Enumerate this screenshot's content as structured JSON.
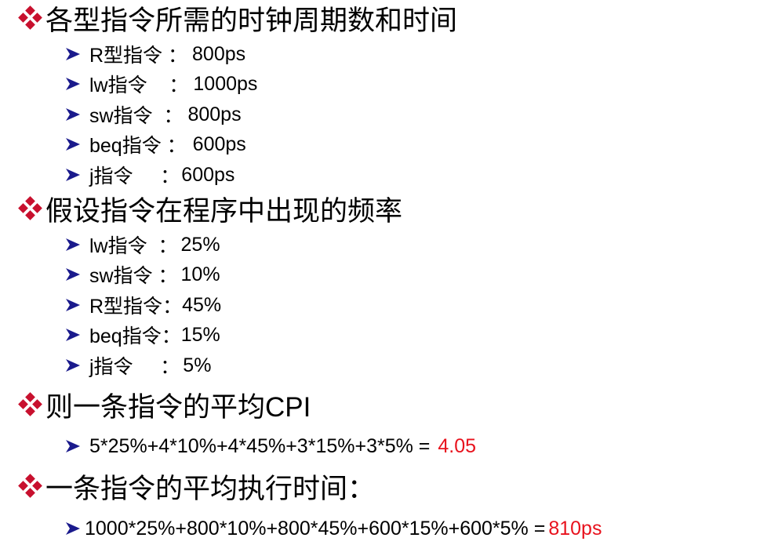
{
  "colors": {
    "accent": "#e8121d",
    "arrow": "#1a1a8c",
    "diamond": "#c8102e",
    "text": "#000000"
  },
  "icons": {
    "heading_marker": "diamond-quad-icon",
    "item_marker": "arrowhead-right-icon"
  },
  "sections": [
    {
      "title": "各型指令所需的时钟周期数和时间",
      "items": [
        {
          "label": "R型指令",
          "sep": " ：",
          "value": "800ps"
        },
        {
          "label": "lw指令",
          "sep": "    ：",
          "value": "1000ps"
        },
        {
          "label": "sw指令",
          "sep": "  ：",
          "value": "800ps"
        },
        {
          "label": "beq指令",
          "sep": " ：",
          "value": "600ps"
        },
        {
          "label": "j指令",
          "sep": "     ：",
          "value": "600ps"
        }
      ]
    },
    {
      "title": "假设指令在程序中出现的频率",
      "items": [
        {
          "label": "lw指令",
          "sep": "  ：",
          "value": "25%"
        },
        {
          "label": "sw指令",
          "sep": " ：",
          "value": "10%"
        },
        {
          "label": "R型指令",
          "sep": "：",
          "value": "45%"
        },
        {
          "label": "beq指令",
          "sep": "：",
          "value": "15%"
        },
        {
          "label": "j指令",
          "sep": "     ：",
          "value": "5%"
        }
      ]
    },
    {
      "title": "则一条指令的平均CPI",
      "formula": "5*25%+4*10%+4*45%+3*15%+3*5% =",
      "result": "4.05"
    },
    {
      "title": "一条指令的平均执行时间：",
      "formula": "1000*25%+800*10%+800*45%+600*15%+600*5% =",
      "result": "810ps"
    }
  ]
}
